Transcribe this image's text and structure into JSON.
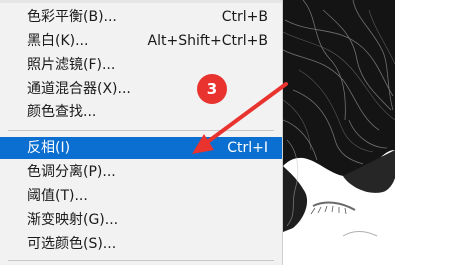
{
  "menu": {
    "items": [
      {
        "label": "色彩平衡(B)...",
        "shortcut": "Ctrl+B"
      },
      {
        "label": "黑白(K)...",
        "shortcut": "Alt+Shift+Ctrl+B"
      },
      {
        "label": "照片滤镜(F)...",
        "shortcut": ""
      },
      {
        "label": "通道混合器(X)...",
        "shortcut": ""
      },
      {
        "label": "颜色查找...",
        "shortcut": ""
      }
    ],
    "items_group2": [
      {
        "label": "反相(I)",
        "shortcut": "Ctrl+I",
        "highlighted": true
      },
      {
        "label": "色调分离(P)...",
        "shortcut": ""
      },
      {
        "label": "阈值(T)...",
        "shortcut": ""
      },
      {
        "label": "渐变映射(G)...",
        "shortcut": ""
      },
      {
        "label": "可选颜色(S)...",
        "shortcut": ""
      }
    ],
    "highlight_color": "#0a6fd0"
  },
  "annotation": {
    "step_number": "3",
    "badge_color": "#e8332f",
    "arrow_color": "#e8332f"
  }
}
